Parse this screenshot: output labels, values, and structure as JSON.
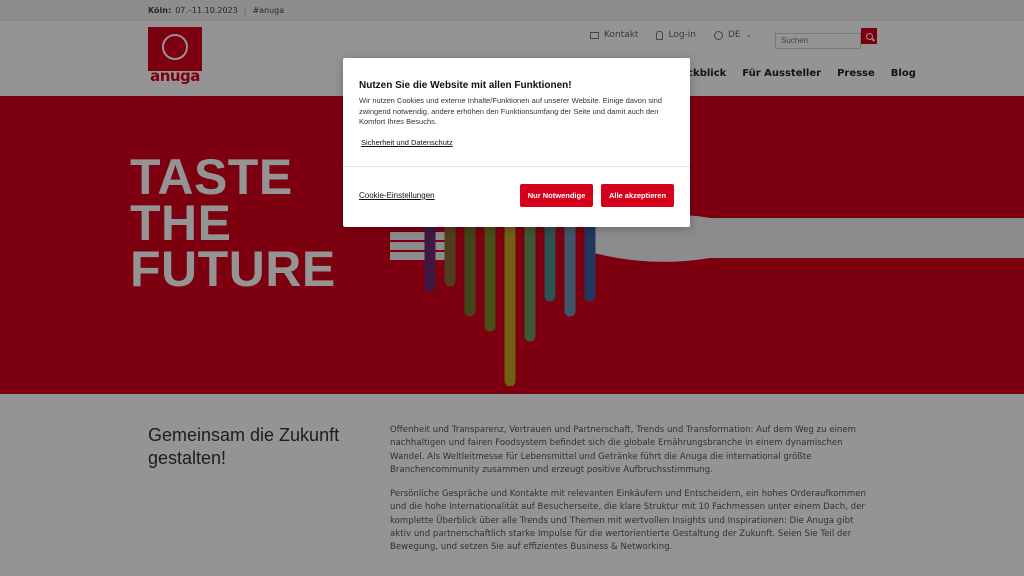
{
  "topbar": {
    "city": "Köln:",
    "dates": "07.–11.10.2023",
    "hashtag": "#anuga"
  },
  "header": {
    "logo_text": "anuga",
    "utility": {
      "contact": "Kontakt",
      "login": "Log-in",
      "language": "DE"
    },
    "search": {
      "placeholder": "Suchen"
    },
    "nav": {
      "rueckblick": "ückblick",
      "aussteller": "Für Aussteller",
      "presse": "Presse",
      "blog": "Blog"
    }
  },
  "hero": {
    "line1": "TASTE",
    "line2": "THE",
    "line3": "FUTURE"
  },
  "content": {
    "heading": "Gemeinsam die Zukunft gestalten!",
    "paragraph1": "Offenheit und Transparenz, Vertrauen und Partnerschaft, Trends und Transformation: Auf dem Weg zu einem nachhaltigen und fairen Foodsystem befindet sich die globale Ernährungsbranche in einem dynamischen Wandel. Als Weltleitmesse für Lebensmittel und Getränke führt die Anuga die international größte Branchencommunity zusammen und erzeugt positive Aufbruchsstimmung.",
    "paragraph2": "Persönliche Gespräche und Kontakte mit relevanten Einkäufern und Entscheidern, ein hohes Orderaufkommen und die hohe Internationalität auf Besucherseite, die klare Struktur mit 10 Fachmessen unter einem Dach, der komplette Überblick über alle Trends und Themen mit wertvollen Insights und Inspirationen: Die Anuga gibt aktiv und partnerschaftlich starke Impulse für die wertorientierte Gestaltung der Zukunft. Seien Sie Teil der Bewegung, und setzen Sie auf effizientes Business & Networking."
  },
  "cookie_modal": {
    "title": "Nutzen Sie die Website mit allen Funktionen!",
    "description": "Wir nutzen Cookies und externe Inhalte/Funktionen auf unserer Website. Einige davon sind zwingend notwendig, andere erhöhen den Funktionsumfang der Seite und damit auch den Komfort Ihres Besuchs.",
    "privacy_link": "Sicherheit und Datenschutz",
    "settings_link": "Cookie-Einstellungen",
    "btn_necessary": "Nur Notwendige",
    "btn_accept": "Alle akzeptieren"
  },
  "colors": {
    "brand_red": "#d6001c",
    "hero_stripes": [
      "#6b2a6e",
      "#8b6b3a",
      "#6f7b2e",
      "#7d8a2a",
      "#c7a629",
      "#6a9a5a",
      "#4f8f8c",
      "#6f97b9",
      "#3c5fa0"
    ]
  }
}
